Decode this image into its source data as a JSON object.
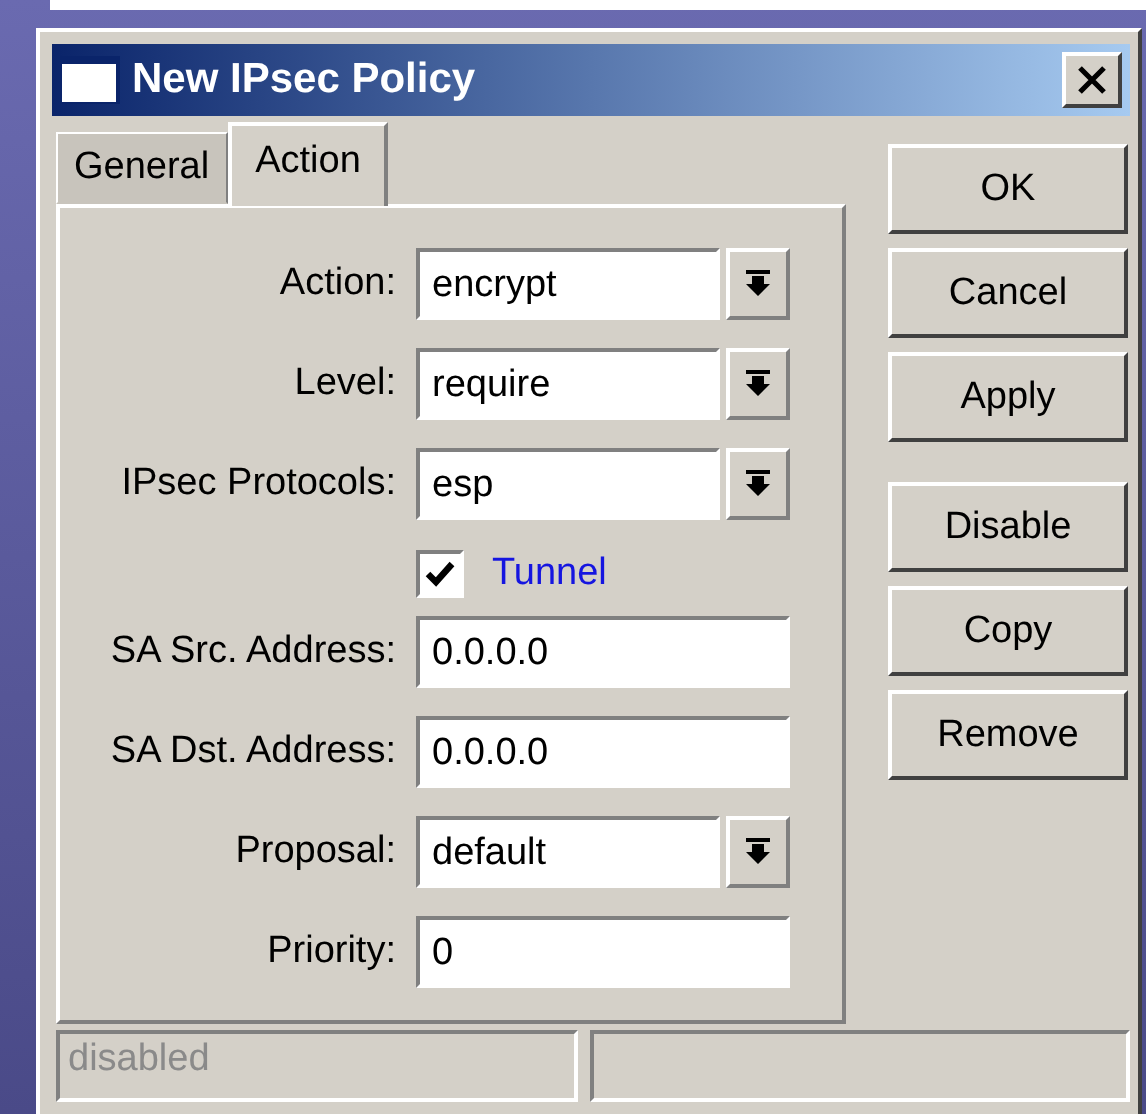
{
  "window": {
    "title": "New IPsec Policy"
  },
  "tabs": [
    {
      "label": "General",
      "selected": false
    },
    {
      "label": "Action",
      "selected": true
    }
  ],
  "fields": [
    {
      "kind": "select",
      "label": "Action:",
      "value": "encrypt"
    },
    {
      "kind": "select",
      "label": "Level:",
      "value": "require"
    },
    {
      "kind": "select",
      "label": "IPsec Protocols:",
      "value": "esp"
    },
    {
      "kind": "checkbox",
      "label": "Tunnel",
      "checked": true
    },
    {
      "kind": "text",
      "label": "SA Src. Address:",
      "value": "0.0.0.0"
    },
    {
      "kind": "text",
      "label": "SA Dst. Address:",
      "value": "0.0.0.0"
    },
    {
      "kind": "select",
      "label": "Proposal:",
      "value": "default"
    },
    {
      "kind": "text",
      "label": "Priority:",
      "value": "0"
    }
  ],
  "button_groups": [
    [
      "OK",
      "Cancel",
      "Apply"
    ],
    [
      "Disable",
      "Copy",
      "Remove"
    ]
  ],
  "status_bar": {
    "state": "disabled"
  }
}
